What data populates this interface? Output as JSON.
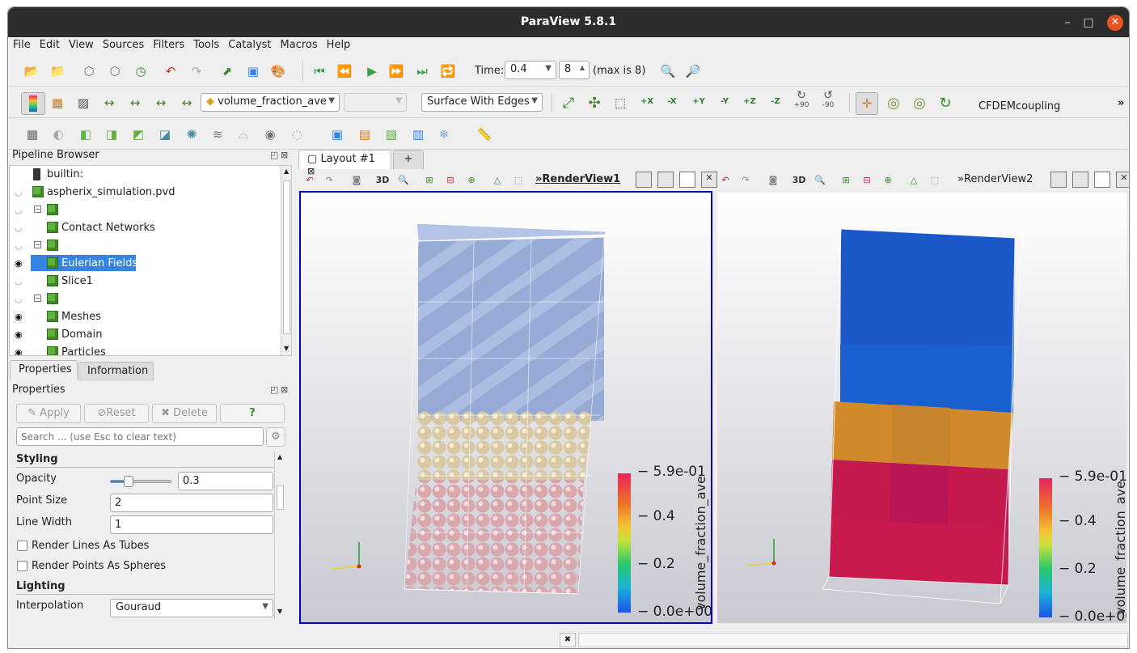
{
  "window": {
    "title": "ParaView 5.8.1",
    "minimize": "–",
    "maximize": "□",
    "close": "✕"
  },
  "menu": [
    "File",
    "Edit",
    "View",
    "Sources",
    "Filters",
    "Tools",
    "Catalyst",
    "Macros",
    "Help"
  ],
  "time": {
    "label": "Time:",
    "value": "0.4",
    "step": "8",
    "max_label": "(max is 8)"
  },
  "color_by": "volume_fraction_ave",
  "component": "",
  "representation": "Surface With Edges",
  "rotate_labels": {
    "plus90": "+90",
    "minus90": "-90"
  },
  "axis_buttons": [
    "+X",
    "-X",
    "+Y",
    "-Y",
    "+Z",
    "-Z"
  ],
  "plugin_label": "CFDEMcoupling",
  "more": "»",
  "pipeline": {
    "title": "Pipeline Browser",
    "items": [
      {
        "label": "builtin:",
        "eye": "none",
        "indent": 0
      },
      {
        "label": "aspherix_simulation.pvd",
        "eye": "off",
        "indent": 0
      },
      {
        "label": "",
        "eye": "off",
        "indent": 1
      },
      {
        "label": "Contact Networks",
        "eye": "off",
        "indent": 2
      },
      {
        "label": "",
        "eye": "off",
        "indent": 1
      },
      {
        "label": "Eulerian Fields",
        "eye": "on",
        "indent": 2,
        "selected": true
      },
      {
        "label": "Slice1",
        "eye": "off",
        "indent": 2
      },
      {
        "label": "",
        "eye": "off",
        "indent": 1
      },
      {
        "label": "Meshes",
        "eye": "on",
        "indent": 2
      },
      {
        "label": "Domain",
        "eye": "on",
        "indent": 2
      },
      {
        "label": "Particles",
        "eye": "on",
        "indent": 2
      }
    ]
  },
  "props": {
    "tabs": [
      "Properties",
      "Information"
    ],
    "title": "Properties",
    "apply": "Apply",
    "reset": "Reset",
    "delete": "Delete",
    "help": "?",
    "search_placeholder": "Search ... (use Esc to clear text)",
    "styling": "Styling",
    "opacity_label": "Opacity",
    "opacity_value": "0.3",
    "opacity_fraction": 0.3,
    "point_size_label": "Point Size",
    "point_size_value": "2",
    "line_width_label": "Line Width",
    "line_width_value": "1",
    "tubes_label": "Render Lines As Tubes",
    "spheres_label": "Render Points As Spheres",
    "lighting": "Lighting",
    "interp_label": "Interpolation",
    "interp_value": "Gouraud"
  },
  "layout_tab": "Layout #1",
  "add_tab": "+",
  "view1": {
    "name": "RenderView1",
    "mode": "3D"
  },
  "view2": {
    "name": "RenderView2",
    "mode": "3D"
  },
  "colorbar": {
    "title": "volume_fraction_ave",
    "ticks": [
      "5.9e-01",
      "0.4",
      "0.2",
      "0.0e+00"
    ]
  },
  "colors": {
    "selection": "#3584e4",
    "active_view_border": "#0000c8",
    "title_bar": "#2c2c2c"
  }
}
